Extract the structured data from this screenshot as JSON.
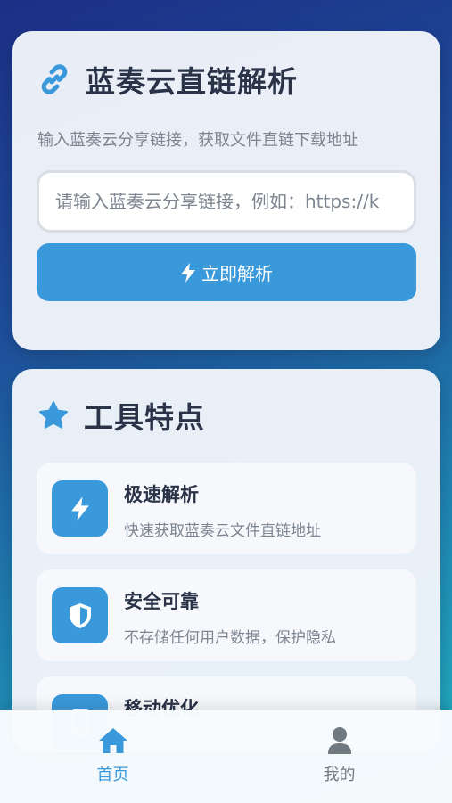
{
  "parser": {
    "title": "蓝奏云直链解析",
    "subtitle": "输入蓝奏云分享链接，获取文件直链下载地址",
    "input_placeholder": "请输入蓝奏云分享链接，例如：https://k",
    "input_value": "",
    "button_label": "立即解析"
  },
  "features": {
    "title": "工具特点",
    "items": [
      {
        "icon": "bolt-icon",
        "name": "极速解析",
        "desc": "快速获取蓝奏云文件直链地址"
      },
      {
        "icon": "shield-icon",
        "name": "安全可靠",
        "desc": "不存储任何用户数据，保护隐私"
      },
      {
        "icon": "mobile-icon",
        "name": "移动优化",
        "desc": ""
      }
    ]
  },
  "nav": {
    "items": [
      {
        "icon": "home-icon",
        "label": "首页",
        "active": true
      },
      {
        "icon": "user-icon",
        "label": "我的",
        "active": false
      }
    ]
  },
  "colors": {
    "accent": "#3a99db",
    "title": "#2a3347",
    "muted": "#7d8590"
  }
}
